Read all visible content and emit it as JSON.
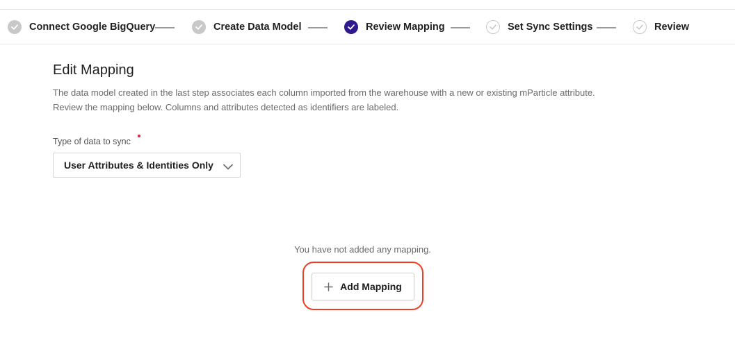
{
  "stepper": {
    "steps": [
      {
        "label": "Connect Google BigQuery",
        "state": "done"
      },
      {
        "label": "Create Data Model",
        "state": "done"
      },
      {
        "label": "Review Mapping",
        "state": "active"
      },
      {
        "label": "Set Sync Settings",
        "state": "pending"
      },
      {
        "label": "Review",
        "state": "pending"
      }
    ]
  },
  "main": {
    "title": "Edit Mapping",
    "description_line1": "The data model created in the last step associates each column imported from the warehouse with a new or existing mParticle attribute.",
    "description_line2": "Review the mapping below. Columns and attributes detected as identifiers are labeled."
  },
  "form": {
    "type_label": "Type of data to sync",
    "type_value": "User Attributes & Identities Only"
  },
  "empty_state": {
    "message": "You have not added any mapping.",
    "add_button_label": "Add Mapping"
  },
  "colors": {
    "active_step": "#2e1a8e",
    "done_step": "#c8c8c8",
    "highlight": "#ea3f26",
    "required": "#e8233a"
  },
  "icons": {
    "step_check": "check-icon",
    "select": "chevron-down-icon",
    "add": "plus-icon"
  }
}
